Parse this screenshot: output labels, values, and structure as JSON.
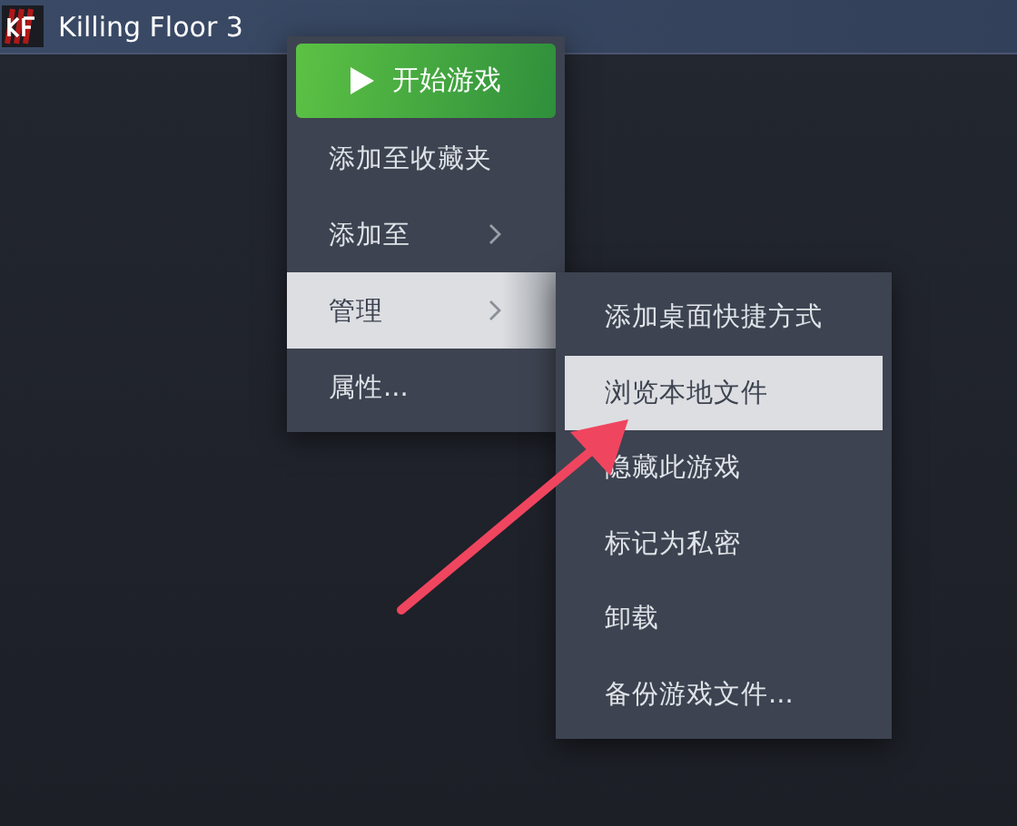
{
  "header": {
    "title": "Killing Floor 3"
  },
  "context_menu": {
    "play_button": {
      "label": "开始游戏"
    },
    "items": [
      {
        "label": "添加至收藏夹",
        "submenu": false,
        "selected": false
      },
      {
        "label": "添加至",
        "submenu": true,
        "selected": false
      },
      {
        "label": "管理",
        "submenu": true,
        "selected": true
      },
      {
        "label": "属性...",
        "submenu": false,
        "selected": false
      }
    ]
  },
  "submenu": {
    "items": [
      {
        "label": "添加桌面快捷方式",
        "selected": false
      },
      {
        "label": "浏览本地文件",
        "selected": true
      },
      {
        "label": "隐藏此游戏",
        "selected": false
      },
      {
        "label": "标记为私密",
        "selected": false
      },
      {
        "label": "卸载",
        "selected": false
      },
      {
        "label": "备份游戏文件...",
        "selected": false
      }
    ]
  }
}
